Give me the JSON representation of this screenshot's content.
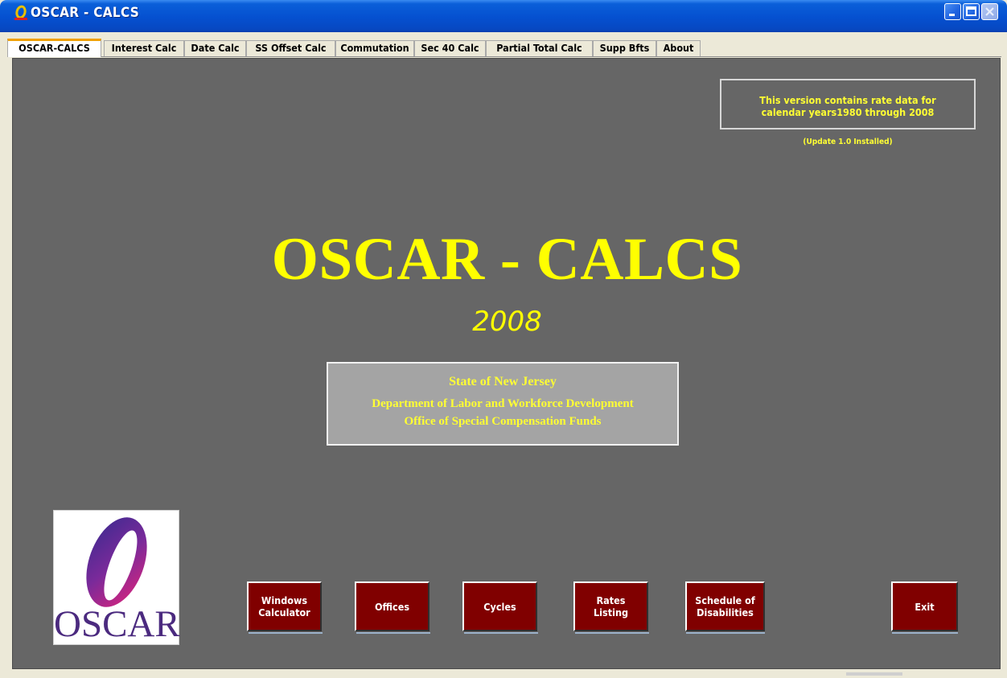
{
  "window": {
    "title": "OSCAR - CALCS",
    "icon": "oscar-app-icon",
    "controls": [
      "minimize",
      "maximize",
      "close"
    ]
  },
  "tabs": [
    {
      "label": "OSCAR-CALCS",
      "active": true
    },
    {
      "label": "Interest Calc",
      "active": false
    },
    {
      "label": "Date Calc",
      "active": false
    },
    {
      "label": "SS Offset Calc",
      "active": false
    },
    {
      "label": "Commutation",
      "active": false
    },
    {
      "label": "Sec 40 Calc",
      "active": false
    },
    {
      "label": "Partial Total Calc",
      "active": false
    },
    {
      "label": "Supp Bfts",
      "active": false
    },
    {
      "label": "About",
      "active": false
    }
  ],
  "rate_info": {
    "line1": "This version contains rate data for",
    "line2": "calendar years1980 through 2008",
    "update": "(Update 1.0 Installed)"
  },
  "main": {
    "title": "OSCAR - CALCS",
    "year": "2008"
  },
  "agency": {
    "line1": "State of New Jersey",
    "line2": "Department of Labor and Workforce Development",
    "line3": "Office of Special Compensation Funds"
  },
  "logo": {
    "letter": "O",
    "word": "OSCAR"
  },
  "buttons": [
    {
      "line1": "Windows",
      "line2": "Calculator"
    },
    {
      "line1": "Offices",
      "line2": ""
    },
    {
      "line1": "Cycles",
      "line2": ""
    },
    {
      "line1": "Rates",
      "line2": "Listing"
    },
    {
      "line1": "Schedule of",
      "line2": "Disabilities"
    },
    {
      "line1": "Exit",
      "line2": ""
    }
  ],
  "colors": {
    "background": "#666666",
    "accent_text": "#ffff00",
    "button": "#800000",
    "titlebar": "#0550d0",
    "logo_gradient": [
      "#4b2a8a",
      "#d8247a"
    ]
  }
}
